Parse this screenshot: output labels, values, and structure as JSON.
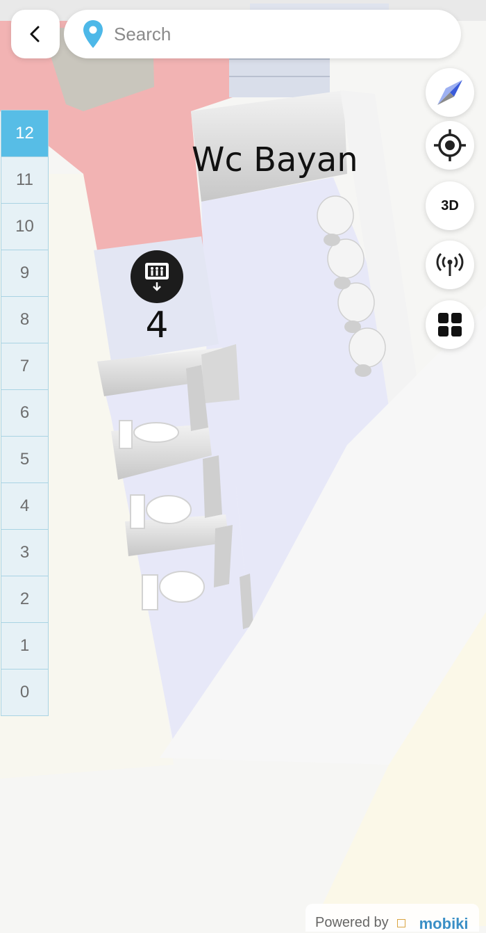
{
  "search": {
    "placeholder": "Search"
  },
  "map": {
    "room_label": "Wc Bayan",
    "elevator_floor": "4",
    "colors": {
      "pink_zone": "#f2b3b3",
      "corridor": "#e6e7f7",
      "wall": "#d9d9d9"
    }
  },
  "controls": {
    "compass_icon": "compass-icon",
    "locate_icon": "crosshair-icon",
    "view_3d_label": "3D",
    "beacon_icon": "broadcast-icon",
    "grid_icon": "grid-icon"
  },
  "floors": [
    "12",
    "11",
    "10",
    "9",
    "8",
    "7",
    "6",
    "5",
    "4",
    "3",
    "2",
    "1",
    "0"
  ],
  "active_floor": "12",
  "footer": {
    "powered_by": "Powered by",
    "brand": "mobiki"
  },
  "accent_color": "#57bde6"
}
